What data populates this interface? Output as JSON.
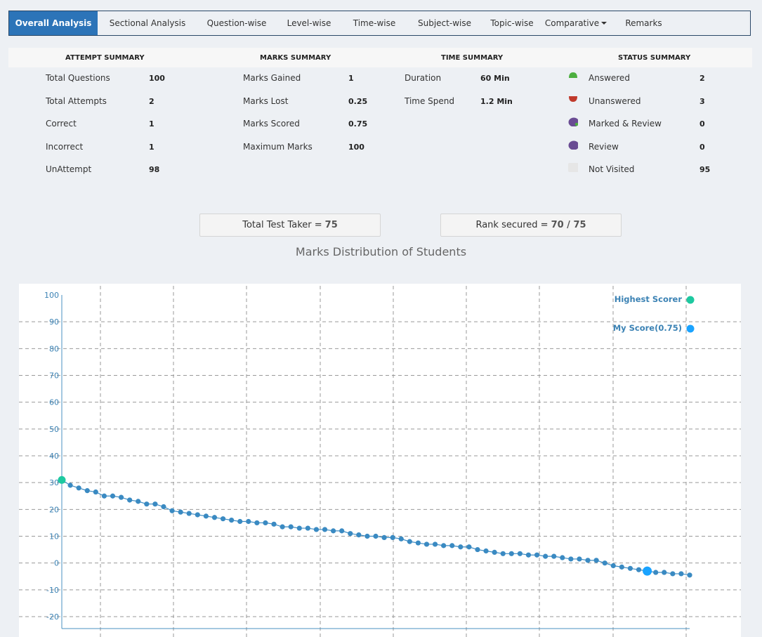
{
  "tabs": [
    {
      "label": "Overall Analysis",
      "active": true
    },
    {
      "label": "Sectional Analysis"
    },
    {
      "label": "Question-wise"
    },
    {
      "label": "Level-wise"
    },
    {
      "label": "Time-wise"
    },
    {
      "label": "Subject-wise"
    },
    {
      "label": "Topic-wise"
    },
    {
      "label": "Comparative"
    },
    {
      "label": "Remarks"
    }
  ],
  "summary": {
    "attempt": {
      "heading": "ATTEMPT SUMMARY",
      "rows": [
        {
          "label": "Total Questions",
          "value": "100"
        },
        {
          "label": "Total Attempts",
          "value": "2"
        },
        {
          "label": "Correct",
          "value": "1"
        },
        {
          "label": "Incorrect",
          "value": "1"
        },
        {
          "label": "UnAttempt",
          "value": "98"
        }
      ]
    },
    "marks": {
      "heading": "MARKS SUMMARY",
      "rows": [
        {
          "label": "Marks Gained",
          "value": "1"
        },
        {
          "label": "Marks Lost",
          "value": "0.25"
        },
        {
          "label": "Marks Scored",
          "value": "0.75"
        },
        {
          "label": "Maximum Marks",
          "value": "100"
        }
      ]
    },
    "time": {
      "heading": "TIME SUMMARY",
      "rows": [
        {
          "label": "Duration",
          "value": "60 Min"
        },
        {
          "label": "Time Spend",
          "value": "1.2 Min"
        }
      ]
    },
    "status": {
      "heading": "STATUS SUMMARY",
      "rows": [
        {
          "label": "Answered",
          "value": "2",
          "color": "#4caf3f"
        },
        {
          "label": "Unanswered",
          "value": "3",
          "color": "#c0392b"
        },
        {
          "label": "Marked & Review",
          "value": "0",
          "color": "#6a4c93"
        },
        {
          "label": "Review",
          "value": "0",
          "color": "#6a4c93"
        },
        {
          "label": "Not Visited",
          "value": "95",
          "color": "#e6e6e6"
        }
      ]
    }
  },
  "stats": {
    "test_takers_label": "Total Test Taker =",
    "test_takers_value": "75",
    "rank_label": "Rank secured =",
    "rank_value": "70 / 75"
  },
  "chart_data": {
    "type": "line",
    "title": "Marks Distribution of Students",
    "ylim": [
      -20,
      100
    ],
    "yticks": [
      100,
      90,
      80,
      70,
      60,
      50,
      40,
      30,
      20,
      10,
      0,
      -10,
      -20
    ],
    "grid": true,
    "legend_position": "top-right",
    "series": [
      {
        "name": "Highest Scorer",
        "color": "#1dc9a0",
        "marker": "first-point"
      },
      {
        "name": "My Score(0.75)",
        "color": "#1aa3ff",
        "marker": "rank-70"
      }
    ],
    "x": [
      1,
      2,
      3,
      4,
      5,
      6,
      7,
      8,
      9,
      10,
      11,
      12,
      13,
      14,
      15,
      16,
      17,
      18,
      19,
      20,
      21,
      22,
      23,
      24,
      25,
      26,
      27,
      28,
      29,
      30,
      31,
      32,
      33,
      34,
      35,
      36,
      37,
      38,
      39,
      40,
      41,
      42,
      43,
      44,
      45,
      46,
      47,
      48,
      49,
      50,
      51,
      52,
      53,
      54,
      55,
      56,
      57,
      58,
      59,
      60,
      61,
      62,
      63,
      64,
      65,
      66,
      67,
      68,
      69,
      70,
      71,
      72,
      73,
      74,
      75
    ],
    "values": [
      31,
      29,
      28,
      27,
      26.5,
      25,
      25,
      24.5,
      23.5,
      23,
      22,
      22,
      21,
      19.5,
      19,
      18.5,
      18,
      17.5,
      17,
      16.5,
      16,
      15.5,
      15.5,
      15,
      15,
      14.5,
      13.5,
      13.5,
      13,
      13,
      12.5,
      12.5,
      12,
      12,
      11,
      10.5,
      10,
      10,
      9.5,
      9.5,
      9,
      8,
      7.5,
      7,
      7,
      6.5,
      6.5,
      6,
      6,
      5,
      4.5,
      4,
      3.5,
      3.5,
      3.5,
      3,
      3,
      2.5,
      2.5,
      2,
      1.5,
      1.5,
      1,
      1,
      0,
      -1,
      -1.5,
      -2,
      -2.5,
      -3,
      -3.5,
      -3.5,
      -4,
      -4,
      -4.5
    ],
    "highest_score": 31,
    "my_score": 0.75,
    "my_rank": 70
  }
}
